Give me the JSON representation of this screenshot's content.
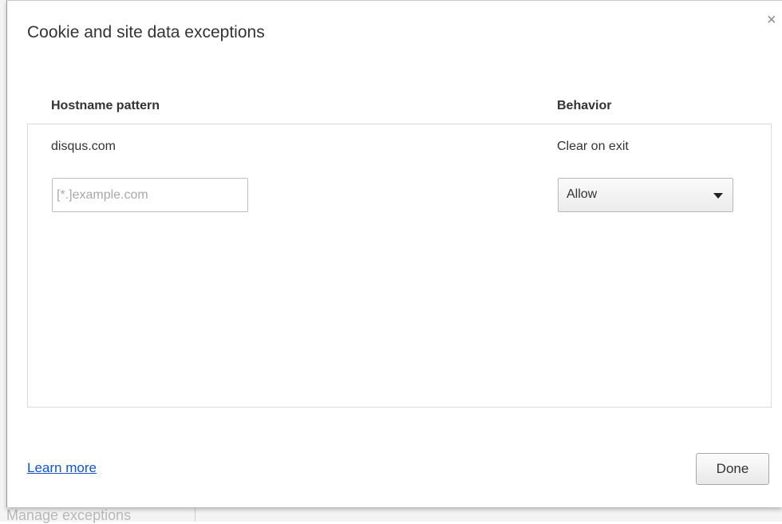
{
  "background": {
    "partial_text": "Manage exceptions"
  },
  "dialog": {
    "title": "Cookie and site data exceptions",
    "close_glyph": "×",
    "columns": {
      "hostname_header": "Hostname pattern",
      "behavior_header": "Behavior"
    },
    "exceptions": [
      {
        "hostname": "disqus.com",
        "behavior": "Clear on exit"
      }
    ],
    "new_entry": {
      "hostname_value": "",
      "hostname_placeholder": "[*.]example.com",
      "behavior_selected": "Allow"
    },
    "footer": {
      "learn_more_label": "Learn more",
      "done_label": "Done"
    }
  },
  "colors": {
    "link": "#1155cc",
    "text": "#333333",
    "placeholder": "#a8a8a8",
    "border": "#dcdcdc"
  },
  "icons": {
    "close": "close-icon",
    "dropdown": "chevron-down-icon"
  }
}
